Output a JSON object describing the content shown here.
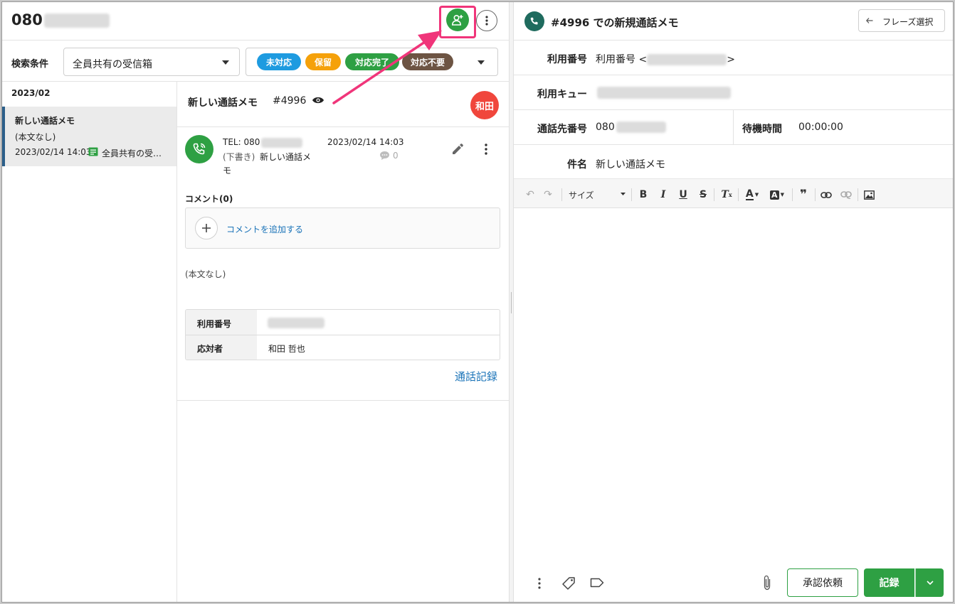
{
  "header": {
    "phone_prefix": "080",
    "add_contact_icon": "person-add-icon",
    "more_icon": "more-vertical-icon"
  },
  "filter": {
    "label": "検索条件",
    "inbox_select": "全員共有の受信箱",
    "status_pills": [
      {
        "label": "未対応",
        "color": "#1e9be0"
      },
      {
        "label": "保留",
        "color": "#f5a10a"
      },
      {
        "label": "対応完了",
        "color": "#2ea043"
      },
      {
        "label": "対応不要",
        "color": "#6d5443"
      }
    ]
  },
  "list": {
    "month": "2023/02",
    "items": [
      {
        "title": "新しい通話メモ",
        "body": "(本文なし)",
        "date": "2023/02/14 14:03",
        "inbox": "全員共有の受…"
      }
    ]
  },
  "detail": {
    "title": "新しい通話メモ",
    "ticket": "#4996",
    "assignee_badge": "和田",
    "assignee_color": "#f0463c",
    "call": {
      "tel_prefix": "TEL: 080",
      "date": "2023/02/14 14:03",
      "draft_label": "(下書き)",
      "subject_line1": "新しい通話メ",
      "subject_line2": "モ",
      "comment_count": "0"
    },
    "comments_header": "コメント(0)",
    "add_comment": "コメントを追加する",
    "body": "(本文なし)",
    "table": [
      {
        "label": "利用番号",
        "value": ""
      },
      {
        "label": "応対者",
        "value": "和田 哲也"
      }
    ],
    "call_record_link": "通話記録"
  },
  "compose": {
    "title": "#4996 での新規通話メモ",
    "phrase_button": "フレーズ選択",
    "fields": {
      "usage_number_label": "利用番号",
      "usage_number_value_prefix": "利用番号 <",
      "usage_number_value_suffix": ">",
      "queue_label": "利用キュー",
      "dest_label": "通話先番号",
      "dest_value_prefix": "080",
      "wait_label": "待機時間",
      "wait_value": "00:00:00",
      "subject_label": "件名",
      "subject_value": "新しい通話メモ"
    },
    "toolbar": {
      "size_label": "サイズ"
    },
    "footer": {
      "approve_button": "承認依頼",
      "record_button": "記録"
    }
  },
  "colors": {
    "accent_green": "#2ea043",
    "highlight": "#f0357a",
    "link_blue": "#1a73b8"
  }
}
